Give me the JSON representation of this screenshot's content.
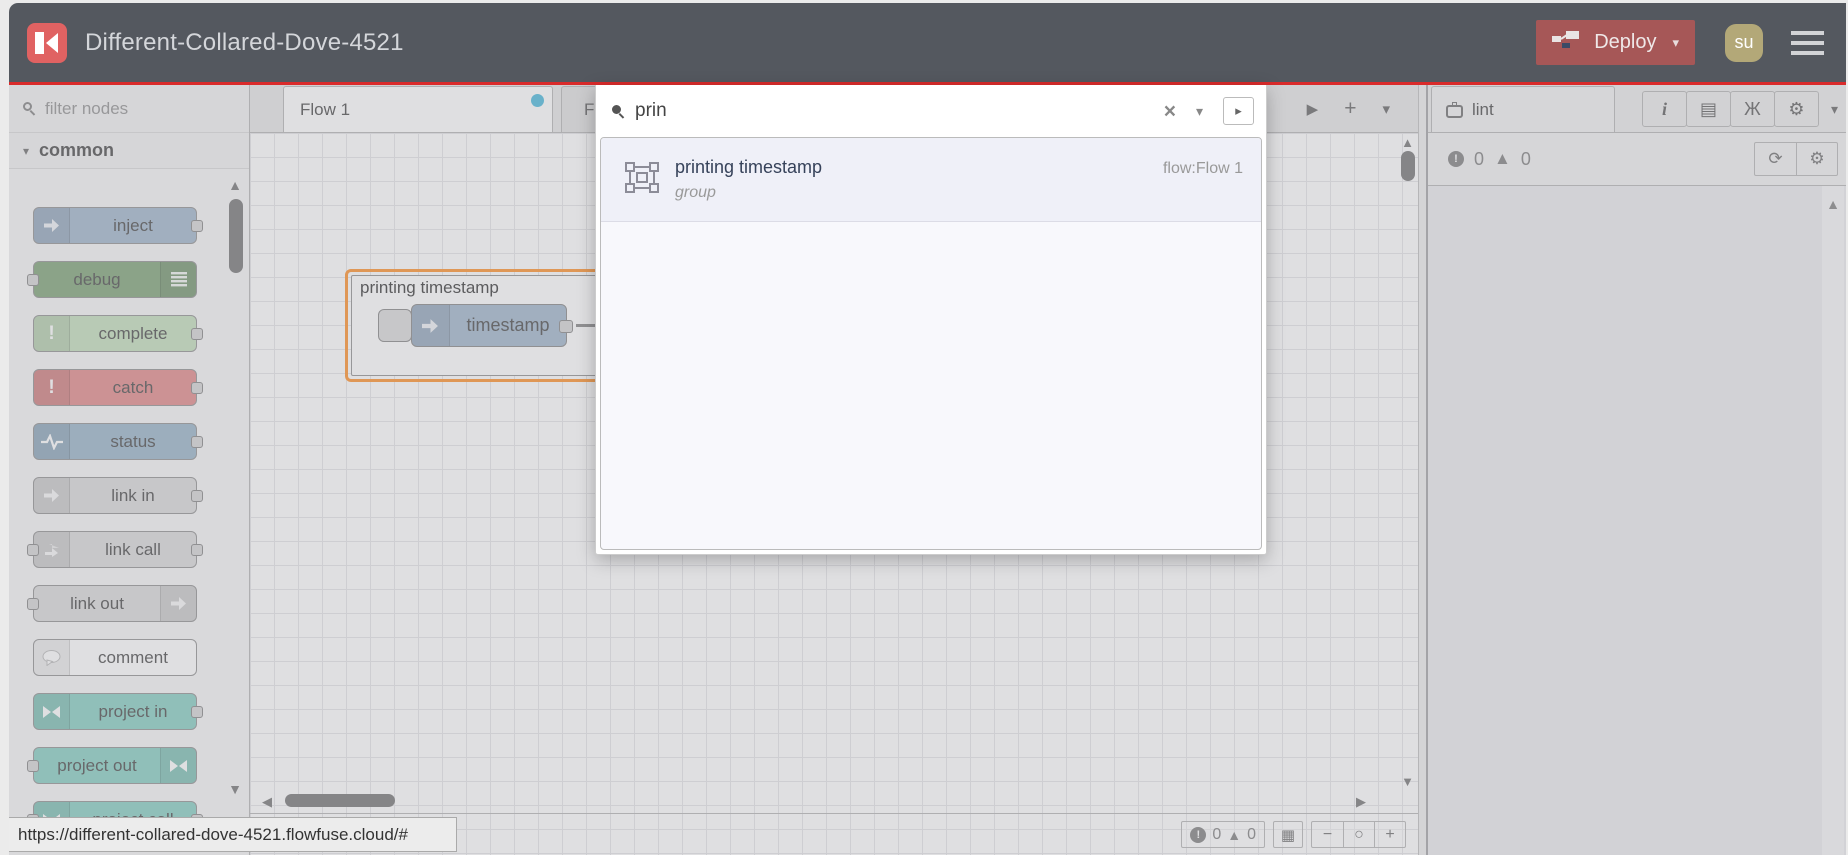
{
  "header": {
    "title": "Different-Collared-Dove-4521",
    "deploy_label": "Deploy",
    "avatar_initials": "su"
  },
  "colors": {
    "header_bg": "#54585f",
    "accent_line": "#d92b2b",
    "deploy_bg": "#a65757",
    "avatar_bg": "#b3a878",
    "unsaved_dot": "#56bede",
    "group_highlight": "#ff9838"
  },
  "palette": {
    "filter_placeholder": "filter nodes",
    "category_label": "common",
    "nodes": [
      {
        "label": "inject",
        "color": "#a6bbcf",
        "icon": "arrow",
        "icon_side": "left",
        "port_left": false,
        "port_right": true
      },
      {
        "label": "debug",
        "color": "#87a980",
        "icon": "list",
        "icon_side": "right",
        "port_left": true,
        "port_right": false
      },
      {
        "label": "complete",
        "color": "#c7e1c0",
        "icon": "exclaim",
        "icon_side": "left",
        "port_left": false,
        "port_right": true
      },
      {
        "label": "catch",
        "color": "#e49191",
        "icon": "exclaim",
        "icon_side": "left",
        "port_left": false,
        "port_right": true
      },
      {
        "label": "status",
        "color": "#9fb9cc",
        "icon": "pulse",
        "icon_side": "left",
        "port_left": false,
        "port_right": true
      },
      {
        "label": "link in",
        "color": "#dddddd",
        "icon": "arrow",
        "icon_side": "left",
        "port_left": false,
        "port_right": true
      },
      {
        "label": "link call",
        "color": "#dddddd",
        "icon": "linkcall",
        "icon_side": "left",
        "port_left": true,
        "port_right": true
      },
      {
        "label": "link out",
        "color": "#dddddd",
        "icon": "arrow",
        "icon_side": "right",
        "port_left": true,
        "port_right": false
      },
      {
        "label": "comment",
        "color": "#ffffff",
        "icon": "bubble",
        "icon_side": "left",
        "port_left": false,
        "port_right": false
      },
      {
        "label": "project in",
        "color": "#8fd2c6",
        "icon": "flowfuse",
        "icon_side": "left",
        "port_left": false,
        "port_right": true
      },
      {
        "label": "project out",
        "color": "#8fd2c6",
        "icon": "flowfuse",
        "icon_side": "right",
        "port_left": true,
        "port_right": false
      },
      {
        "label": "project call",
        "color": "#8fd2c6",
        "icon": "flowfuse",
        "icon_side": "left",
        "port_left": true,
        "port_right": true
      }
    ]
  },
  "tabs": {
    "active_label": "Flow 1",
    "next_label": "Fl"
  },
  "canvas": {
    "group_label": "printing timestamp",
    "inject_label": "timestamp"
  },
  "search": {
    "query": "prin",
    "results": [
      {
        "title": "printing timestamp",
        "location": "flow:Flow 1",
        "type": "group"
      }
    ]
  },
  "sidebar": {
    "tab_label": "lint",
    "error_count": "0",
    "warning_count": "0"
  },
  "canvas_footer": {
    "error_count": "0",
    "warning_count": "0"
  },
  "statusbar": {
    "url": "https://different-collared-dove-4521.flowfuse.cloud/#"
  }
}
